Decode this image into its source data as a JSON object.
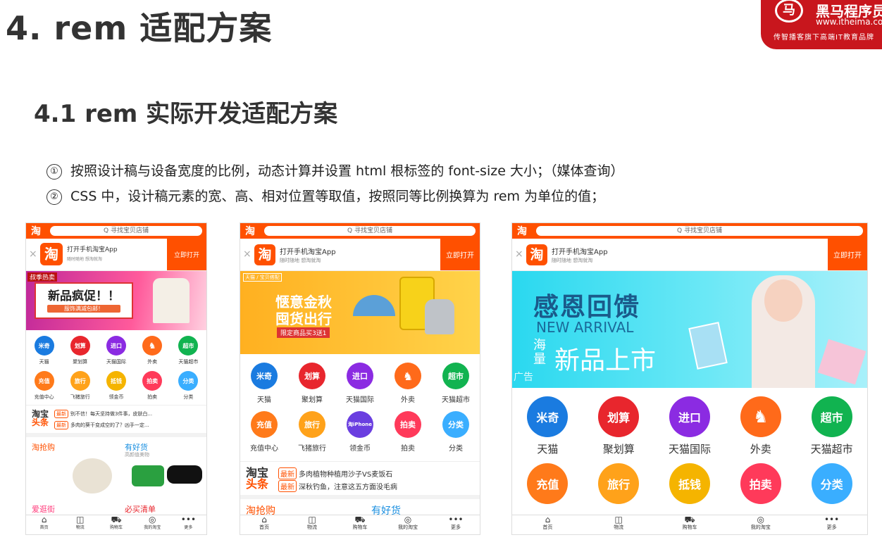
{
  "title": "4. rem 适配方案",
  "logo": {
    "name": "黑马程序员",
    "url": "www.itheima.com",
    "tagline": "传智播客旗下高端IT教育品牌",
    "mark": "马"
  },
  "subtitle": "4.1 rem 实际开发适配方案",
  "points": [
    {
      "num": "①",
      "text": "按照设计稿与设备宽度的比例，动态计算并设置 html 根标签的 font-size 大小；（媒体查询）"
    },
    {
      "num": "②",
      "text": "CSS 中，设计稿元素的宽、高、相对位置等取值，按照同等比例换算为 rem 为单位的值；"
    }
  ],
  "phone": {
    "logo": "淘",
    "search": "Q 寻找宝贝店铺",
    "close": "×",
    "app_title": "打开手机淘宝App",
    "app_sub": "随时随地 想淘就淘",
    "open_btn": "立即打开",
    "icons_row1": [
      {
        "top": "米奇",
        "sub": "生日快乐",
        "label": "天猫",
        "color": "#1a7be0"
      },
      {
        "top": "划算",
        "sub": "¥",
        "label": "聚划算",
        "color": "#e8262d"
      },
      {
        "top": "进口",
        "sub": "",
        "label": "天猫国际",
        "color": "#8b2be2"
      },
      {
        "top": "♞",
        "sub": "",
        "label": "外卖",
        "color": "#ff6a1a"
      },
      {
        "top": "超市",
        "sub": "",
        "label": "天猫超市",
        "color": "#11b350"
      }
    ],
    "icons_row2": [
      {
        "top": "充值",
        "label": "充值中心",
        "color": "#ff7a1a"
      },
      {
        "top": "旅行",
        "label": "飞猪旅行",
        "color": "#ffa21a"
      },
      {
        "top": "抵钱",
        "top_alt": "淘iPhone",
        "label": "领金币",
        "color": "#f5b400",
        "alt_color": "#6a3ee0"
      },
      {
        "top": "拍卖",
        "label": "拍卖",
        "color": "#ff3a5a"
      },
      {
        "top": "分类",
        "label": "分类",
        "color": "#3aaeff"
      }
    ],
    "headline_logo": [
      "淘宝",
      "头条"
    ],
    "news_tag": "最新",
    "news1": [
      "别不信！每天坚持做3件事，皮肤白...",
      "多肉的葵干变成空的了？凶手一定..."
    ],
    "news2": [
      "多肉植物种植用沙子VS麦饭石",
      "深秋钓鱼，注意这五方面没毛病"
    ],
    "sections": [
      "淘抢购",
      "有好货",
      "高颜值美物",
      "爱逛街",
      "必买清单"
    ],
    "banner1": {
      "tag": "叔季热卖",
      "main": "新品疯促！！",
      "sub": "服饰满减包邮！"
    },
    "banner2": {
      "brands": "天猫 / 宝贝搭配",
      "line1": "惬意金秋",
      "line2": "囤货出行",
      "promo": "限定商品买3送1"
    },
    "banner3": {
      "line1": "感恩回馈",
      "line2": "NEW ARRIVAL",
      "line3a": "海量",
      "line3b": "新品上市",
      "ad": "广告"
    },
    "footer": [
      {
        "icon": "⌂",
        "label": "首页"
      },
      {
        "icon": "◫",
        "label": "物流"
      },
      {
        "icon": "⛟",
        "label": "购物车"
      },
      {
        "icon": "◎",
        "label": "我的淘宝"
      },
      {
        "icon": "•••",
        "label": "更多"
      }
    ]
  }
}
